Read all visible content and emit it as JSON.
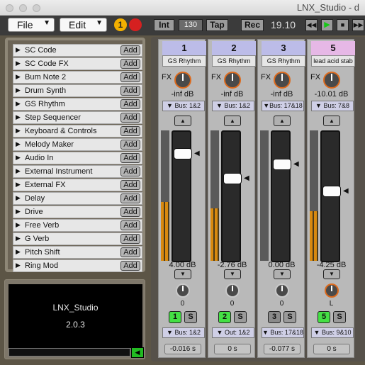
{
  "window": {
    "title": "LNX_Studio - d"
  },
  "toolbar": {
    "file": "File",
    "edit": "Edit",
    "warning": "1",
    "int": "Int",
    "tempo": "130",
    "tap": "Tap",
    "rec": "Rec",
    "counter": "19.10",
    "rewind": "◀◀",
    "play": "▶",
    "stop": "■",
    "forward": "▶▶"
  },
  "library": {
    "add_label": "Add",
    "items": [
      {
        "label": "SC Code"
      },
      {
        "label": "SC Code FX"
      },
      {
        "label": "Bum Note 2"
      },
      {
        "label": "Drum Synth"
      },
      {
        "label": "GS Rhythm"
      },
      {
        "label": "Step Sequencer"
      },
      {
        "label": "Keyboard & Controls"
      },
      {
        "label": "Melody Maker"
      },
      {
        "label": "Audio In"
      },
      {
        "label": "External Instrument"
      },
      {
        "label": "External FX"
      },
      {
        "label": "Delay"
      },
      {
        "label": "Drive"
      },
      {
        "label": "Free Verb"
      },
      {
        "label": "G Verb"
      },
      {
        "label": "Pitch Shift"
      },
      {
        "label": "Ring Mod"
      }
    ]
  },
  "info": {
    "app": "LNX_Studio",
    "version": "2.0.3"
  },
  "mixer": {
    "fx_label": "FX",
    "solo_label": "S",
    "channels": [
      {
        "num": "1",
        "name": "GS Rhythm",
        "send_db": "-inf dB",
        "bus_in": "▼ Bus: 1&2",
        "level_db": "4.00 dB",
        "level": 0.86,
        "pan": "0",
        "out": "▼ Bus: 1&2",
        "latency": "-0.016 s",
        "meter": 0.45,
        "num_color": "#bcbce8",
        "btn_color": "#44e044"
      },
      {
        "num": "2",
        "name": "GS Rhythm",
        "send_db": "-inf dB",
        "bus_in": "▼ Bus: 1&2",
        "level_db": "-2.76 dB",
        "level": 0.65,
        "pan": "0",
        "out": "▼ Out: 1&2",
        "latency": "0 s",
        "meter": 0.4,
        "num_color": "#bcbce8",
        "btn_color": "#44e044"
      },
      {
        "num": "3",
        "name": "GS Rhythm",
        "send_db": "-inf dB",
        "bus_in": "▼Bus: 17&18",
        "level_db": "0.00 dB",
        "level": 0.77,
        "pan": "0",
        "out": "▼ Bus: 17&18",
        "latency": "-0.077 s",
        "meter": 0,
        "num_color": "#bcbce8",
        "btn_color": "#8a8a8a"
      },
      {
        "num": "5",
        "name": "lead acid stab",
        "send_db": "-10.01 dB",
        "bus_in": "▼ Bus: 7&8",
        "level_db": "-4.25 dB",
        "level": 0.54,
        "pan": "L",
        "out": "▼ Bus: 9&10",
        "latency": "0 s",
        "meter": 0.38,
        "num_color": "#e6b8e6",
        "btn_color": "#44e044"
      }
    ]
  }
}
